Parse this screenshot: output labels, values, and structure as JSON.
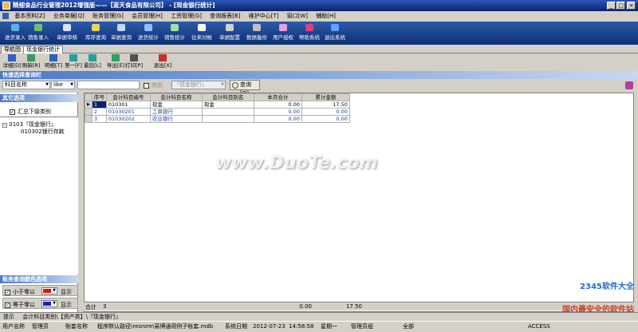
{
  "window": {
    "title": "精细食品行业管理2012增强版——【蓝天食品有限公司】 - [现金银行统计]",
    "controls": {
      "minimize": "_",
      "maximize": "□",
      "close": "×"
    }
  },
  "menu": [
    "基本资料[Z]",
    "业务单据[Q]",
    "账务管理[G]",
    "会员管理[H]",
    "工资管理[G]",
    "查询报表[B]",
    "维护中心[T]",
    "窗口[W]",
    "辅助[H]"
  ],
  "toolbar": [
    {
      "label": "进货录入",
      "icon": "import-icon",
      "color": "#60b0e8"
    },
    {
      "label": "销售录入",
      "icon": "sales-entry-icon",
      "color": "#70c070"
    },
    {
      "label": "单据审核",
      "icon": "audit-icon",
      "color": "#e0e0ff"
    },
    {
      "label": "库存查询",
      "icon": "stock-query-icon",
      "color": "#f0d060"
    },
    {
      "label": "单据查询",
      "icon": "doc-query-icon",
      "color": "#c0d8ff"
    },
    {
      "label": "进货统计",
      "icon": "purchase-stat-icon",
      "color": "#90c0ff"
    },
    {
      "label": "销售统计",
      "icon": "sales-stat-icon",
      "color": "#a0e0a0"
    },
    {
      "label": "往来对帐",
      "icon": "reconcile-icon",
      "color": "#ffffff"
    },
    {
      "label": "单据配置",
      "icon": "doc-config-icon",
      "color": "#d0d0d0"
    },
    {
      "label": "数据备份",
      "icon": "backup-icon",
      "color": "#c0c0c0"
    },
    {
      "label": "用户授权",
      "icon": "user-auth-icon",
      "color": "#e0a0e0"
    },
    {
      "label": "帮助系统",
      "icon": "help-icon",
      "color": "#e04080"
    },
    {
      "label": "退出系统",
      "icon": "exit-icon",
      "color": "#60a0ff"
    }
  ],
  "tabs": [
    {
      "label": "导航图"
    },
    {
      "label": "现金银行统计"
    }
  ],
  "report_toolbar": [
    {
      "label": "详细[D]",
      "icon": "detail-icon"
    },
    {
      "label": "刷新[R]",
      "icon": "refresh-icon"
    },
    {
      "label": "明细[T]",
      "icon": "list-icon"
    },
    {
      "label": "第一[F]",
      "icon": "first-icon"
    },
    {
      "label": "最后[L]",
      "icon": "last-icon"
    },
    {
      "label": "导出[E]",
      "icon": "export-icon"
    },
    {
      "label": "打印[P]",
      "icon": "print-icon"
    },
    {
      "label": "退出[X]",
      "icon": "close-report-icon"
    }
  ],
  "quick_search": {
    "header": "快速选择查询栏",
    "field": "科目名称",
    "operator": "like",
    "value": "",
    "category_label": "类别",
    "category_value": "『现金银行』",
    "query_button": "查询[Q]"
  },
  "left_panel": {
    "other_options_header": "其它选项",
    "summarize_label": "汇总下级类别",
    "tree_root": "0103『现金银行』",
    "tree_child": "010302银行存款",
    "color_header": "账务查询颜色选项",
    "less_than_zero": "小于零以",
    "less_color": "#e01010",
    "equal_zero": "等于零以",
    "equal_color": "#1020d0",
    "show_label": "显示"
  },
  "grid": {
    "columns": [
      "序号",
      "会计科目编号",
      "会计科目名称",
      "会计科目别名",
      "本月合计",
      "累计金额"
    ],
    "rows": [
      {
        "no": "1",
        "code": "010301",
        "name": "现金",
        "alias": "现金",
        "month": "0.00",
        "total": "17.50"
      },
      {
        "no": "2",
        "code": "01030201",
        "name": "工商银行",
        "alias": "",
        "month": "0.00",
        "total": "0.00"
      },
      {
        "no": "3",
        "code": "01030202",
        "name": "农业银行",
        "alias": "",
        "month": "0.00",
        "total": "0.00"
      }
    ],
    "footer": {
      "label": "合计",
      "count": "3",
      "month": "0.00",
      "total": "17.50"
    }
  },
  "hint_bar": {
    "label": "提示",
    "text": "会计科目类别\\【资产类】\\『现金银行』"
  },
  "status_bar": {
    "user_label": "用户名称",
    "user": "管理员",
    "account_label": "账套名称",
    "account": "程序默认路径\\resrore\\易博通用例子帐套.mdb",
    "date_label": "系统日期",
    "date": "2012-07-23",
    "time": "14:58:58",
    "weekday": "星期一",
    "role": "管理员组",
    "scope": "全部",
    "db": "ACCESS"
  },
  "watermark": {
    "main": "www.DuoTe.com",
    "brand": "2345软件大全",
    "slogan": "国内最安全的软件站"
  }
}
